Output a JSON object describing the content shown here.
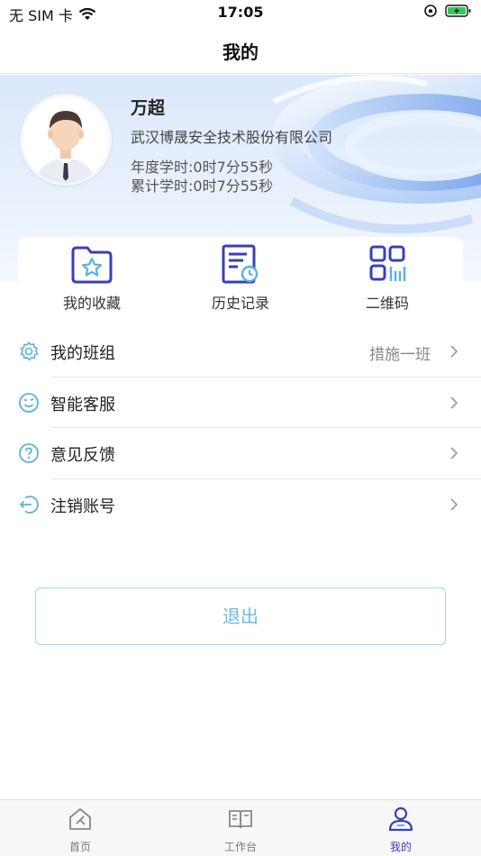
{
  "status": {
    "carrier": "无 SIM 卡",
    "time": "17:05"
  },
  "nav": {
    "title": "我的"
  },
  "profile": {
    "name": "万超",
    "company": "武汉博晟安全技术股份有限公司",
    "year_hours": "年度学时:0时7分55秒",
    "total_hours": "累计学时:0时7分55秒"
  },
  "quick": [
    {
      "label": "我的收藏",
      "icon": "folder-star-icon"
    },
    {
      "label": "历史记录",
      "icon": "history-icon"
    },
    {
      "label": "二维码",
      "icon": "qrcode-icon"
    }
  ],
  "menu": [
    {
      "label": "我的班组",
      "value": "措施一班",
      "icon": "gear-icon"
    },
    {
      "label": "智能客服",
      "value": "",
      "icon": "smile-icon"
    },
    {
      "label": "意见反馈",
      "value": "",
      "icon": "question-icon"
    },
    {
      "label": "注销账号",
      "value": "",
      "icon": "logout-icon"
    }
  ],
  "logout_label": "退出",
  "tabs": [
    {
      "label": "首页",
      "icon": "home-icon",
      "active": false
    },
    {
      "label": "工作台",
      "icon": "book-icon",
      "active": false
    },
    {
      "label": "我的",
      "icon": "user-icon",
      "active": true
    }
  ],
  "colors": {
    "accent": "#3a3fb8",
    "light_blue": "#6bbbe6",
    "hero_bg": "#dbe8fb"
  }
}
